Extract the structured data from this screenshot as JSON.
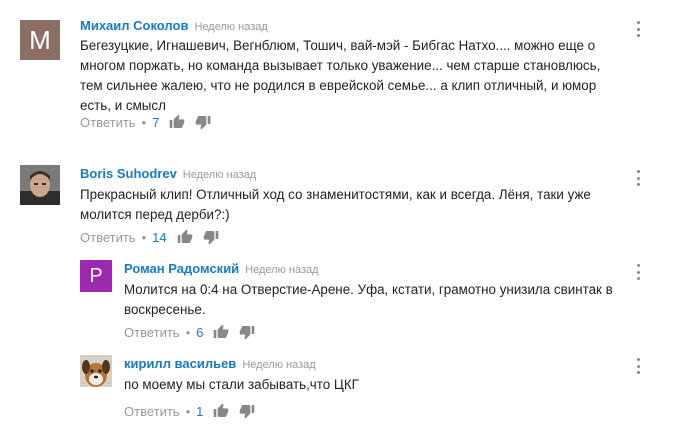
{
  "comments": [
    {
      "author": "Михаил Соколов",
      "time": "Неделю назад",
      "avatar_letter": "M",
      "avatar_color": "#8d6e63",
      "lines": [
        "Бегезуцкие, Игнашевич, Вегнблюм, Тошич, вай-мэй - Бибгас Натхо.... можно еще о",
        "многом поржать, но команда вызывает только уважение... чем старше становлюсь,",
        "тем сильнее жалею, что не родился в еврейской семье... а клип отличный, и юмор",
        "есть, и смысл"
      ],
      "reply_label": "Ответить",
      "likes": "7"
    },
    {
      "author": "Boris Suhodrev",
      "time": "Неделю назад",
      "avatar_icon": "person-photo-avatar",
      "lines": [
        "Прекрасный клип! Отличный ход со знаменитостями, как и всегда. Лёня, таки уже",
        "молится перед дерби?:)"
      ],
      "reply_label": "Ответить",
      "likes": "14"
    },
    {
      "author": "Роман Радомский",
      "time": "Неделю назад",
      "avatar_letter": "P",
      "avatar_color": "#9c27b0",
      "lines": [
        "Молится на 0:4 на Отверстие-Арене. Уфа, кстати, грамотно унизила свинтак в",
        "воскресенье."
      ],
      "reply_label": "Ответить",
      "likes": "6"
    },
    {
      "author": "кирилл васильев",
      "time": "Неделю назад",
      "avatar_icon": "dog-photo-avatar",
      "lines": [
        "по моему  мы стали забывать,что ЦКГ"
      ],
      "reply_label": "Ответить",
      "likes": "1"
    }
  ],
  "colors": {
    "link": "#167ac6",
    "muted": "#999999",
    "text": "#222222"
  },
  "icons": {
    "like": "thumbs-up-icon",
    "dislike": "thumbs-down-icon",
    "menu": "more-vertical-icon"
  }
}
